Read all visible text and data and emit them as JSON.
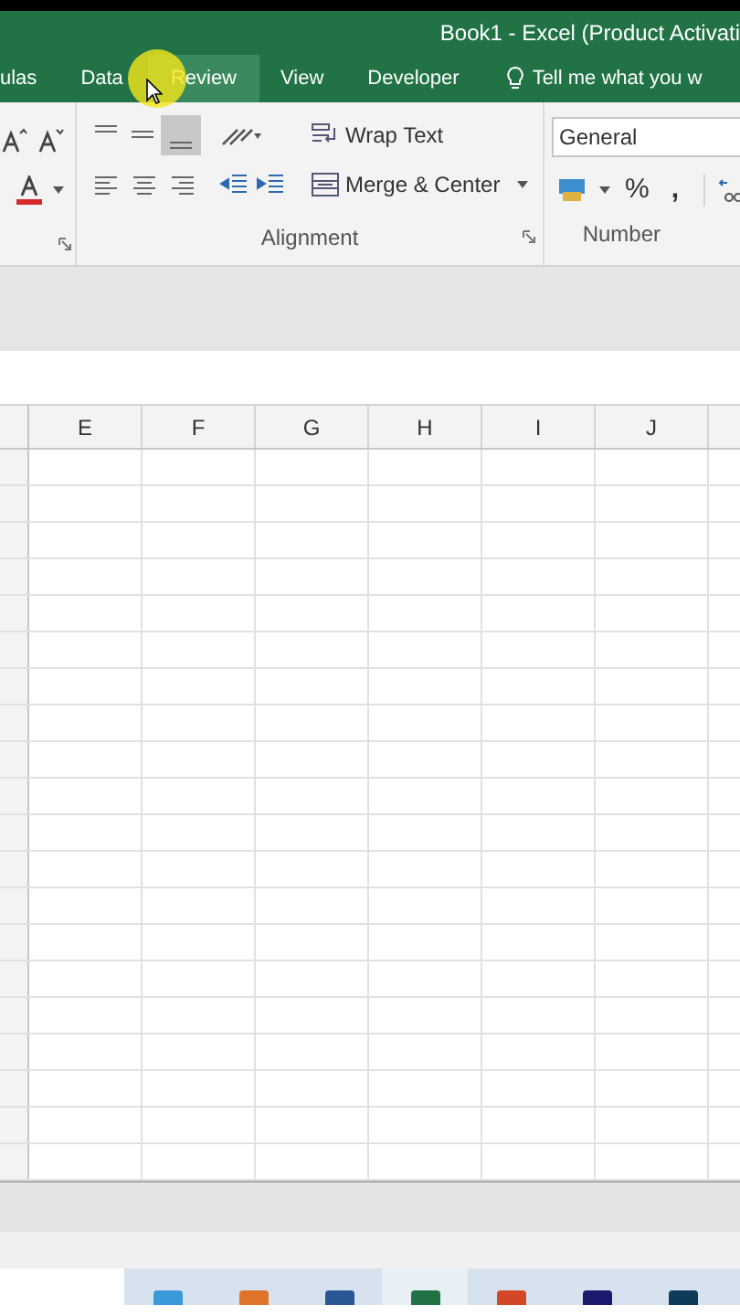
{
  "window": {
    "title": "Book1 - Excel (Product Activati"
  },
  "tabs": [
    {
      "label": "ulas",
      "selected": false
    },
    {
      "label": "Data",
      "selected": false
    },
    {
      "label": "Review",
      "selected": true
    },
    {
      "label": "View",
      "selected": false
    },
    {
      "label": "Developer",
      "selected": false
    }
  ],
  "tell_me": {
    "placeholder": "Tell me what you w"
  },
  "ribbon": {
    "alignment": {
      "wrap_text": "Wrap Text",
      "merge_center": "Merge & Center",
      "label": "Alignment"
    },
    "number": {
      "format": "General",
      "percent": "%",
      "comma": ",",
      "label": "Number"
    }
  },
  "sheet": {
    "columns": [
      "E",
      "F",
      "G",
      "H",
      "I",
      "J"
    ]
  },
  "taskbar": [
    {
      "kind": "folder"
    },
    {
      "kind": "orange"
    },
    {
      "kind": "word"
    },
    {
      "kind": "excel",
      "selected": true
    },
    {
      "kind": "powerpoint"
    },
    {
      "kind": "dreamweaver"
    },
    {
      "kind": "photoshop"
    }
  ]
}
